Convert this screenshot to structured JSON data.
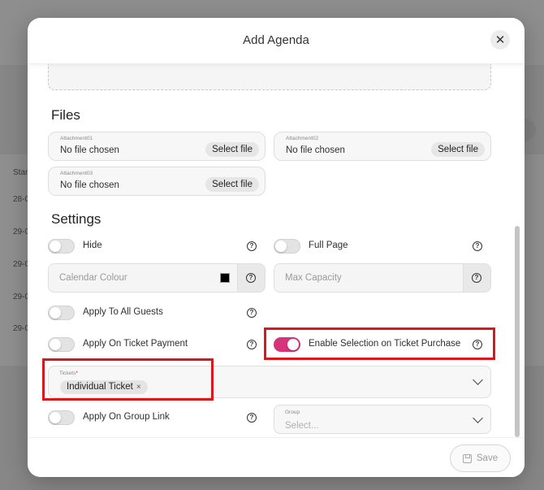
{
  "background": {
    "column_label": "Star",
    "row_dates": [
      "28-0",
      "29-0",
      "29-0",
      "29-0",
      "29-0"
    ]
  },
  "modal": {
    "title": "Add Agenda",
    "close_glyph": "✕"
  },
  "files": {
    "heading": "Files",
    "items": [
      {
        "label": "Attachment01",
        "value": "No file chosen",
        "button": "Select file"
      },
      {
        "label": "Attachment02",
        "value": "No file chosen",
        "button": "Select file"
      },
      {
        "label": "Attachment03",
        "value": "No file chosen",
        "button": "Select file"
      }
    ]
  },
  "settings": {
    "heading": "Settings",
    "help_glyph": "?",
    "hide": {
      "label": "Hide",
      "enabled": false
    },
    "full_page": {
      "label": "Full Page",
      "enabled": false
    },
    "calendar_colour": {
      "placeholder": "Calendar Colour",
      "color": "#000000"
    },
    "max_capacity": {
      "placeholder": "Max Capacity"
    },
    "apply_all_guests": {
      "label": "Apply To All Guests",
      "enabled": false
    },
    "apply_ticket_payment": {
      "label": "Apply On Ticket Payment",
      "enabled": false
    },
    "enable_selection": {
      "label": "Enable Selection on Ticket Purchase",
      "enabled": true
    },
    "tickets": {
      "label": "Tickets",
      "required_mark": "*",
      "selected": [
        "Individual Ticket"
      ],
      "remove_glyph": "×"
    },
    "apply_group_link": {
      "label": "Apply On Group Link",
      "enabled": false
    },
    "group": {
      "label": "Group",
      "placeholder": "Select..."
    }
  },
  "footer": {
    "save_label": "Save"
  },
  "colors": {
    "accent_toggle": "#d6337a",
    "highlight": "#d9171c"
  }
}
